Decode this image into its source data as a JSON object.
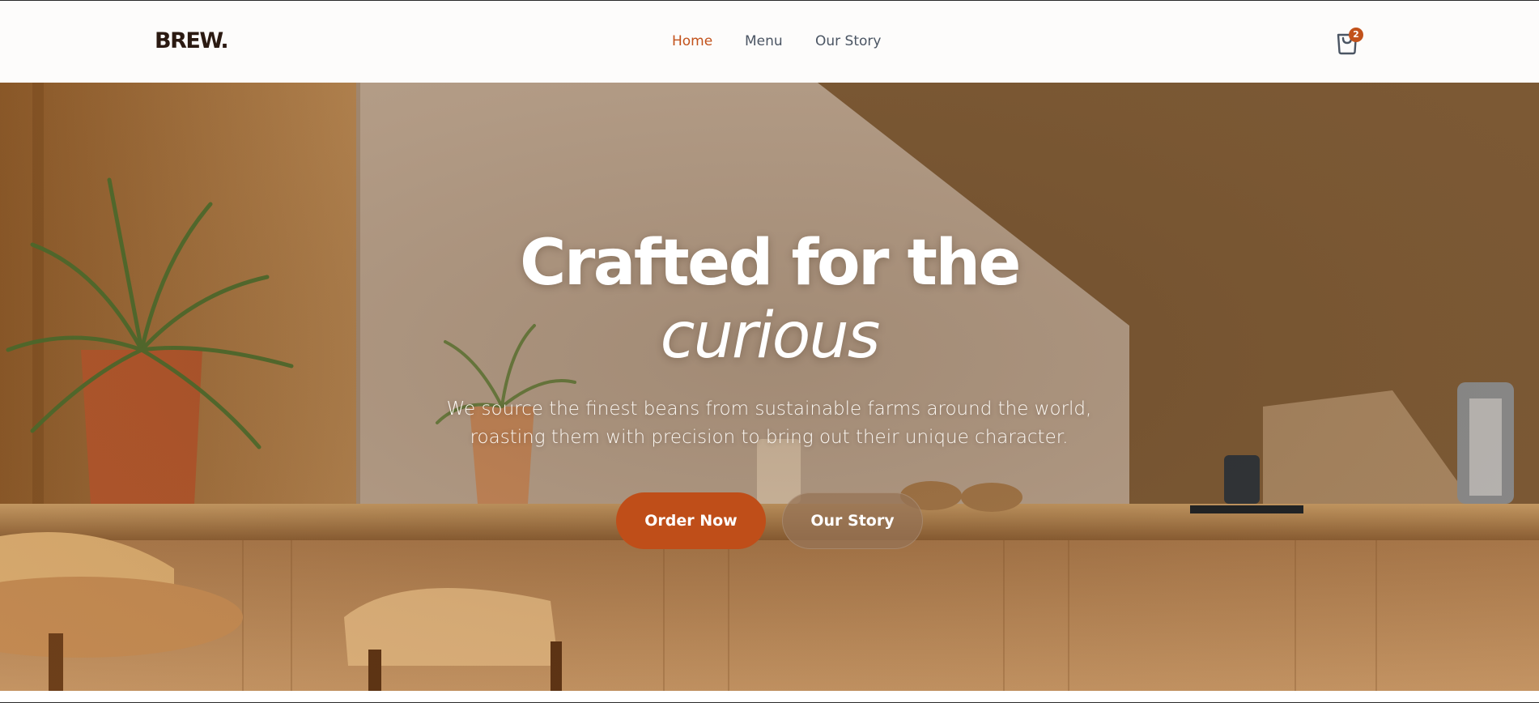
{
  "brand": {
    "logo": "BREW."
  },
  "nav": {
    "items": [
      {
        "label": "Home",
        "active": true
      },
      {
        "label": "Menu",
        "active": false
      },
      {
        "label": "Our Story",
        "active": false
      }
    ]
  },
  "cart": {
    "icon": "shopping-bag-icon",
    "count": "2"
  },
  "hero": {
    "headline": "Crafted for the",
    "headline_accent": "curious",
    "subtext": "We source the finest beans from sustainable farms around the world, roasting them with precision to bring out their unique character.",
    "primary_cta": "Order Now",
    "secondary_cta": "Our Story"
  },
  "colors": {
    "accent": "#c2521b",
    "nav_text": "#4b5563",
    "logo": "#2b1a12",
    "header_bg": "#fdfcfb"
  }
}
